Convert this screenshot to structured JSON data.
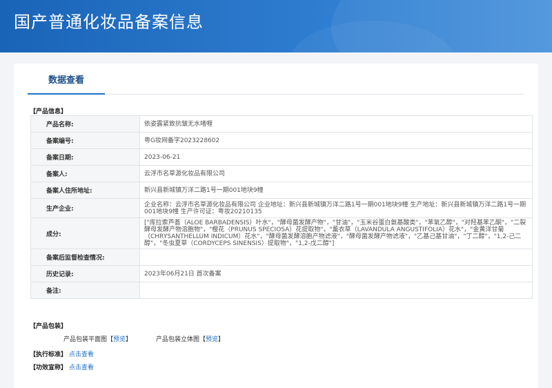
{
  "header": {
    "title": "国产普通化妆品备案信息"
  },
  "tabs": {
    "active": "数据查看"
  },
  "product_info": {
    "section_title": "【产品信息】",
    "rows": [
      {
        "label": "产品名称:",
        "value": "依姿露紧致抗皱无水啫喱"
      },
      {
        "label": "备案编号:",
        "value": "粤G妆网备字2023228602"
      },
      {
        "label": "备案日期:",
        "value": "2023-06-21"
      },
      {
        "label": "备案人:",
        "value": "云浮市名草源化妆品有限公司"
      },
      {
        "label": "备案人住所地址:",
        "value": "新兴县新城镇万洋二路1号一期001地块9幢"
      },
      {
        "label": "生产企业:",
        "value": "企业名称：云浮市名草源化妆品有限公司 企业地址：新兴县新城镇万洋二路1号一期001地块9幢 生产地址：新兴县新城镇万洋二路1号一期001地块9幢 生产许可证：粤妆20210135"
      },
      {
        "label": "成分:",
        "value": "[\"库拉索芦荟（ALOE BARBADENSIS）叶水\"，\"酵母菌发酵产物\"，\"甘油\"，\"玉米谷蛋白氨基酸类\"，\"苯氧乙醇\"，\"对羟基苯乙酮\"，\"二裂酵母发酵产物溶胞物\"，\"樱花（PRUNUS SPECIOSA）花提取物\"，\"薰衣草（LAVANDULA ANGUSTIFOLIA）花水\"，\"金黄洋甘菊（CHRYSANTHELLUM INDICUM）花水\"，\"酵母菌发酵溶胞产物滤液\"，\"酵母菌发酵产物滤液\"，\"乙基己基甘油\"，\"丁二醇\"，\"1,2-己二醇\"，\"冬虫夏草（CORDYCEPS SINENSIS）提取物\"，\"1,2-戊二醇\"]"
      },
      {
        "label": "备案后监督检查情况:",
        "value": ""
      },
      {
        "label": "历史记录:",
        "value": "2023年06月21日 首次备案"
      },
      {
        "label": "备注:",
        "value": ""
      }
    ]
  },
  "packaging": {
    "section_title": "【产品包装】",
    "flat_label": "产品包装平面图",
    "flat_bracket_open": "【",
    "flat_link": "预览",
    "flat_bracket_close": "】",
    "solid_label": "产品包装立体图",
    "solid_bracket_open": "【",
    "solid_link": "预览",
    "solid_bracket_close": "】"
  },
  "standards": {
    "label": "【执行标准】",
    "link": "点击查看"
  },
  "efficacy": {
    "label": "【功效宣称】",
    "link": "点击查看"
  }
}
